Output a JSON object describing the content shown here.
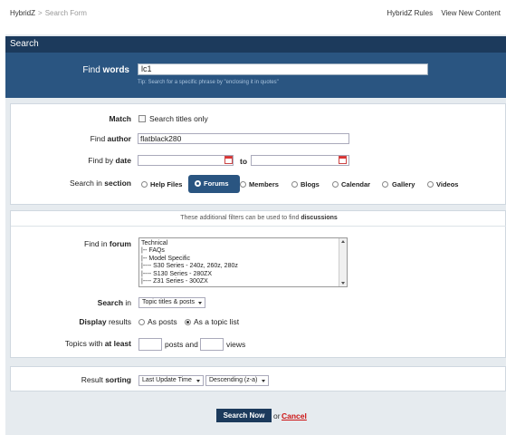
{
  "breadcrumb": {
    "home": "HybridZ",
    "separator": ">",
    "current": "Search Form"
  },
  "top_links": [
    "HybridZ Rules",
    "View New Content"
  ],
  "search_header": "Search",
  "find_words": {
    "label_prefix": "Find ",
    "label_bold": "words",
    "value": "lc1",
    "tip": "Tip: Search for a specific phrase by \"enclosing it in quotes\""
  },
  "match": {
    "label": "Match",
    "option": "Search titles only",
    "checked": false
  },
  "find_author": {
    "label_prefix": "Find ",
    "label_bold": "author",
    "value": "flatblack280"
  },
  "find_date": {
    "label_prefix": "Find by ",
    "label_bold": "date",
    "from": "",
    "to_label": "to",
    "to": ""
  },
  "search_section": {
    "label_prefix": "Search in ",
    "label_bold": "section",
    "options": [
      "Help Files",
      "Forums",
      "Members",
      "Blogs",
      "Calendar",
      "Gallery",
      "Videos"
    ],
    "selected": "Forums"
  },
  "filters_note": {
    "prefix": "These additional filters can be used to find ",
    "bold": "discussions"
  },
  "find_forum": {
    "label_prefix": "Find in ",
    "label_bold": "forum",
    "items": [
      "Technical",
      "|-- FAQs",
      "|-- Model Specific",
      "|---- S30 Series - 240z, 260z, 280z",
      "|---- S130 Series - 280ZX",
      "|---- Z31 Series - 300ZX"
    ]
  },
  "search_in": {
    "label_bold": "Search",
    "label_suffix": " in",
    "value": "Topic titles & posts"
  },
  "display_results": {
    "label_bold": "Display",
    "label_suffix": " results",
    "options": [
      "As posts",
      "As a topic list"
    ],
    "selected": "As a topic list"
  },
  "at_least": {
    "label_prefix": "Topics with ",
    "label_bold": "at least",
    "posts_value": "",
    "posts_label": "posts and",
    "views_value": "",
    "views_label": "views"
  },
  "result_sorting": {
    "label_prefix": "Result ",
    "label_bold": "sorting",
    "sort_by": "Last Update Time",
    "order": "Descending (z-a)"
  },
  "actions": {
    "submit": "Search Now",
    "or": "or",
    "cancel": "Cancel"
  }
}
